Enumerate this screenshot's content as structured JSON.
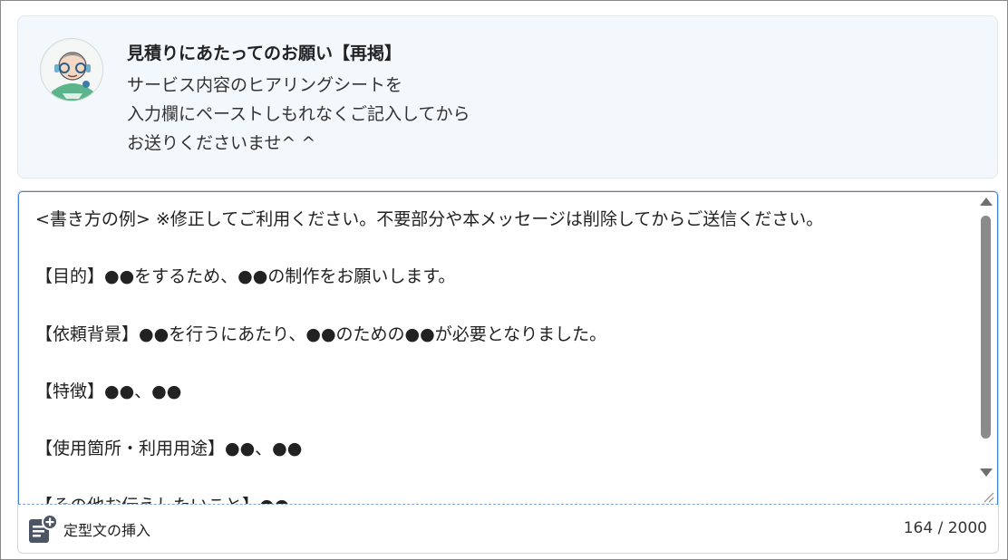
{
  "notice": {
    "title": "見積りにあたってのお願い【再掲】",
    "lines": [
      "サービス内容のヒアリングシートを",
      "入力欄にペーストしもれなくご記入してから",
      "お送りくださいませ^ ^"
    ]
  },
  "message_input": {
    "lines": [
      "<書き方の例> ※修正してご利用ください。不要部分や本メッセージは削除してからご送信ください。",
      "【目的】●●をするため、●●の制作をお願いします。",
      "【依頼背景】●●を行うにあたり、●●のための●●が必要となりました。",
      "【特徴】●●、●●",
      "【使用箇所・利用用途】●●、●●",
      "【その他お伝えしたいこと】●●"
    ],
    "scroll_position": 0.0
  },
  "footer": {
    "insert_template_label": "定型文の挿入",
    "char_count": "164",
    "char_separator": " / ",
    "char_limit": "2000"
  },
  "icons": {
    "avatar": "avatar-icon",
    "insert_template": "document-add-icon"
  },
  "colors": {
    "notice_bg": "#f3f8fd",
    "input_border_focus": "#3d82d6",
    "icon_color": "#4b5563"
  }
}
